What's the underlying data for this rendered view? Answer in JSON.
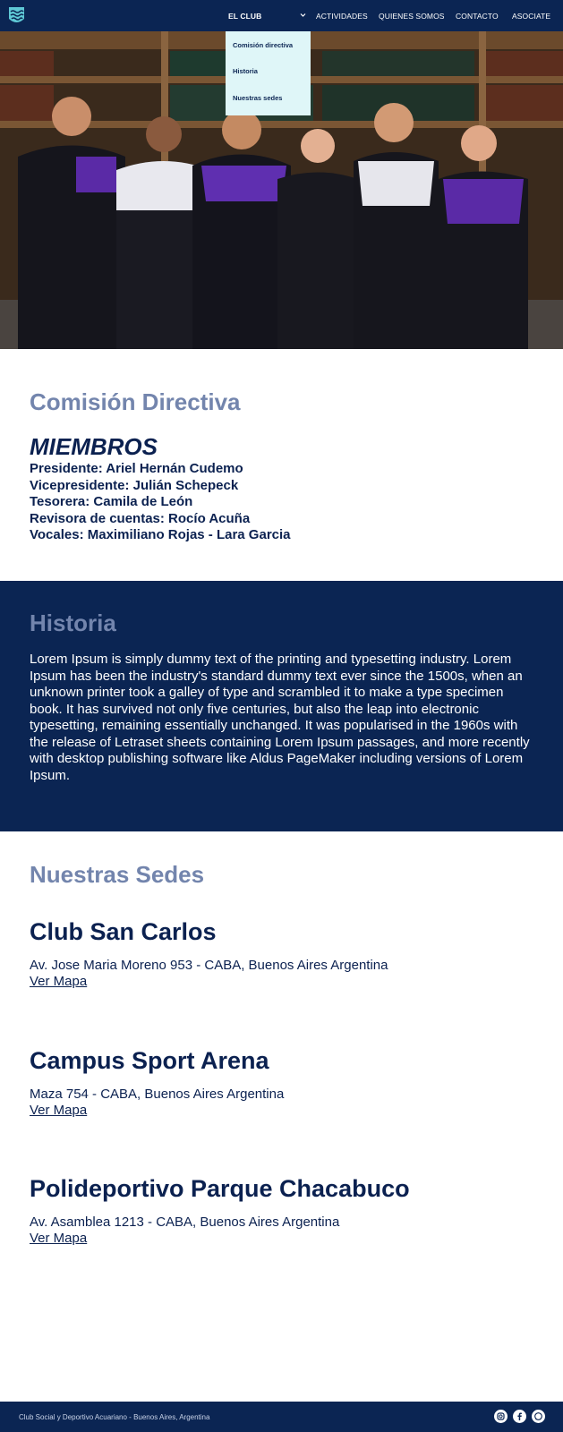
{
  "nav": {
    "items": [
      {
        "label": "EL CLUB"
      },
      {
        "label": "ACTIVIDADES"
      },
      {
        "label": "QUIENES SOMOS"
      },
      {
        "label": "CONTACTO"
      },
      {
        "label": "ASOCIATE"
      }
    ],
    "dropdown": [
      {
        "label": "Comisión directiva"
      },
      {
        "label": "Historia"
      },
      {
        "label": "Nuestras sedes"
      }
    ],
    "colors": {
      "navbar": "#0b2553",
      "dropdown_bg": "#dff6f8"
    }
  },
  "comision": {
    "title": "Comisión Directiva",
    "subtitle": "MIEMBROS",
    "members": [
      "Presidente: Ariel Hernán Cudemo",
      "Vicepresidente: Julián Schepeck",
      "Tesorera: Camila de León",
      "Revisora de cuentas: Rocío Acuña",
      "Vocales: Maximiliano Rojas - Lara Garcia"
    ]
  },
  "historia": {
    "title": "Historia",
    "text": "Lorem Ipsum is simply dummy text of the printing and typesetting industry. Lorem Ipsum has been the industry's standard dummy text ever since the 1500s, when an unknown printer took a galley of type and scrambled it to make a type specimen book. It has survived not only five centuries, but also the leap into electronic typesetting, remaining essentially unchanged. It was popularised in the 1960s with the release of Letraset sheets containing Lorem Ipsum passages, and more recently with desktop publishing software like Aldus PageMaker including versions of Lorem Ipsum."
  },
  "sedes": {
    "title": "Nuestras Sedes",
    "items": [
      {
        "name": "Club San Carlos",
        "address": "Av. Jose Maria Moreno 953 - CABA, Buenos Aires Argentina",
        "link": "Ver Mapa"
      },
      {
        "name": "Campus Sport Arena",
        "address": "Maza 754 - CABA, Buenos Aires Argentina",
        "link": "Ver Mapa"
      },
      {
        "name": "Polideportivo Parque Chacabuco",
        "address": "Av. Asamblea 1213 - CABA, Buenos Aires Argentina",
        "link": "Ver Mapa"
      }
    ]
  },
  "footer": {
    "text": "Club Social y Deportivo Acuariano - Buenos Aires, Argentina",
    "social": [
      "instagram-icon",
      "facebook-icon",
      "whatsapp-icon"
    ]
  }
}
